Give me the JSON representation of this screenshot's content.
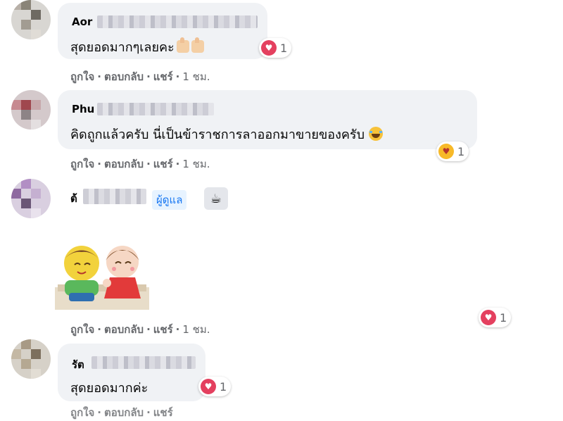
{
  "colors": {
    "bubble": "#f0f2f5",
    "action_text": "#65676b",
    "heart": "#e4405f",
    "admin_badge_bg": "#e7f3ff",
    "admin_badge_text": "#1877f2"
  },
  "actions": {
    "like": "ถูกใจ",
    "reply": "ตอบกลับ",
    "share": "แชร์",
    "separator": "·"
  },
  "comments": [
    {
      "author_visible": "Aor",
      "text": "สุดยอดมากๆเลยคะ",
      "emoji": [
        "thumbs-up-light",
        "thumbs-up-light"
      ],
      "reaction": {
        "icon": "heart-icon",
        "count": "1"
      },
      "time": "1 ชม."
    },
    {
      "author_visible": "Phu",
      "text": "คิดถูกแล้วครับ นี่เป็นข้าราชการลาออกมาขายของครับ",
      "emoji": [
        "tears-of-joy"
      ],
      "reaction": {
        "icon": "care-icon",
        "count": "1"
      },
      "time": "1 ชม."
    },
    {
      "author_visible": "ต้",
      "badge": "ผู้ดูแล",
      "badge_icon": "coffee-cup-icon",
      "sticker": "two-kids-sticker",
      "reaction": {
        "icon": "heart-icon",
        "count": "1"
      },
      "time": "1 ชม."
    },
    {
      "author_visible": "รัต",
      "text": "สุดยอดมากค่ะ",
      "reaction": {
        "icon": "heart-icon",
        "count": "1"
      }
    }
  ]
}
